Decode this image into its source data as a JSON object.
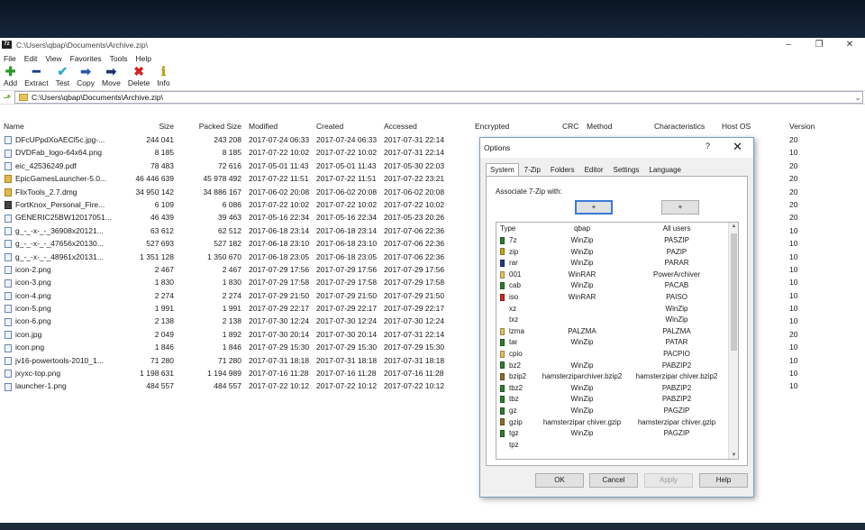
{
  "window": {
    "title": "C:\\Users\\qbap\\Documents\\Archive.zip\\",
    "app_icon_text": "7z"
  },
  "menu": [
    "File",
    "Edit",
    "View",
    "Favorites",
    "Tools",
    "Help"
  ],
  "toolbar": [
    {
      "label": "Add",
      "icon": "plus-icon",
      "glyph": "✚",
      "color": "#2a9a2a"
    },
    {
      "label": "Extract",
      "icon": "minus-icon",
      "glyph": "━",
      "color": "#1e3f8c"
    },
    {
      "label": "Test",
      "icon": "check-icon",
      "glyph": "✔",
      "color": "#2aa9c9"
    },
    {
      "label": "Copy",
      "icon": "copy-arrow-icon",
      "glyph": "➡",
      "color": "#2a5aa9"
    },
    {
      "label": "Move",
      "icon": "move-arrow-icon",
      "glyph": "➡",
      "color": "#1e2f6c"
    },
    {
      "label": "Delete",
      "icon": "delete-x-icon",
      "glyph": "✖",
      "color": "#d42020"
    },
    {
      "label": "Info",
      "icon": "info-icon",
      "glyph": "ℹ",
      "color": "#c29a10"
    }
  ],
  "address": {
    "value": "C:\\Users\\qbap\\Documents\\Archive.zip\\"
  },
  "columns": [
    "Name",
    "Size",
    "Packed Size",
    "Modified",
    "Created",
    "Accessed",
    "Encrypted",
    "CRC",
    "Method",
    "Characteristics",
    "Host OS",
    "Version"
  ],
  "files": [
    {
      "name": "DFcUPpdXoAECl5c.jpg-...",
      "size": "244 041",
      "packed": "243 208",
      "modified": "2017-07-24 06:33",
      "created": "2017-07-24 06:33",
      "accessed": "2017-07-31 22:14",
      "version": "20",
      "kind": "file"
    },
    {
      "name": "DVDFab_logo-64x64.png",
      "size": "8 185",
      "packed": "8 185",
      "modified": "2017-07-22 10:02",
      "created": "2017-07-22 10:02",
      "accessed": "2017-07-31 22:14",
      "version": "10",
      "kind": "file"
    },
    {
      "name": "eic_42536249.pdf",
      "size": "78 483",
      "packed": "72 616",
      "modified": "2017-05-01 11:43",
      "created": "2017-05-01 11:43",
      "accessed": "2017-05-30 22:03",
      "version": "20",
      "kind": "file"
    },
    {
      "name": "EpicGamesLauncher-5.0...",
      "size": "46 446 639",
      "packed": "45 978 492",
      "modified": "2017-07-22 11:51",
      "created": "2017-07-22 11:51",
      "accessed": "2017-07-22 23:21",
      "version": "20",
      "kind": "folder"
    },
    {
      "name": "FlixTools_2.7.dmg",
      "size": "34 950 142",
      "packed": "34 886 167",
      "modified": "2017-06-02 20:08",
      "created": "2017-06-02 20:08",
      "accessed": "2017-06-02 20:08",
      "version": "20",
      "kind": "folder"
    },
    {
      "name": "FortKnox_Personal_Fire...",
      "size": "6 109",
      "packed": "6 086",
      "modified": "2017-07-22 10:02",
      "created": "2017-07-22 10:02",
      "accessed": "2017-07-22 10:02",
      "version": "20",
      "kind": "app"
    },
    {
      "name": "GENERIC25BW12017051...",
      "size": "46 439",
      "packed": "39 463",
      "modified": "2017-05-16 22:34",
      "created": "2017-05-16 22:34",
      "accessed": "2017-05-23 20:26",
      "version": "20",
      "kind": "file"
    },
    {
      "name": "g_-_-x-_-_36908x20121...",
      "size": "63 612",
      "packed": "62 512",
      "modified": "2017-06-18 23:14",
      "created": "2017-06-18 23:14",
      "accessed": "2017-07-06 22:36",
      "version": "10",
      "kind": "file"
    },
    {
      "name": "g_-_-x-_-_47656x20130...",
      "size": "527 693",
      "packed": "527 182",
      "modified": "2017-06-18 23:10",
      "created": "2017-06-18 23:10",
      "accessed": "2017-07-06 22:36",
      "version": "10",
      "kind": "file"
    },
    {
      "name": "g_-_-x-_-_48961x20131...",
      "size": "1 351 128",
      "packed": "1 350 670",
      "modified": "2017-06-18 23:05",
      "created": "2017-06-18 23:05",
      "accessed": "2017-07-06 22:36",
      "version": "10",
      "kind": "file"
    },
    {
      "name": "icon-2.png",
      "size": "2 467",
      "packed": "2 467",
      "modified": "2017-07-29 17:56",
      "created": "2017-07-29 17:56",
      "accessed": "2017-07-29 17:56",
      "version": "10",
      "kind": "file"
    },
    {
      "name": "icon-3.png",
      "size": "1 830",
      "packed": "1 830",
      "modified": "2017-07-29 17:58",
      "created": "2017-07-29 17:58",
      "accessed": "2017-07-29 17:58",
      "version": "10",
      "kind": "file"
    },
    {
      "name": "icon-4.png",
      "size": "2 274",
      "packed": "2 274",
      "modified": "2017-07-29 21:50",
      "created": "2017-07-29 21:50",
      "accessed": "2017-07-29 21:50",
      "version": "10",
      "kind": "file"
    },
    {
      "name": "icon-5.png",
      "size": "1 991",
      "packed": "1 991",
      "modified": "2017-07-29 22:17",
      "created": "2017-07-29 22:17",
      "accessed": "2017-07-29 22:17",
      "version": "10",
      "kind": "file"
    },
    {
      "name": "icon-6.png",
      "size": "2 138",
      "packed": "2 138",
      "modified": "2017-07-30 12:24",
      "created": "2017-07-30 12:24",
      "accessed": "2017-07-30 12:24",
      "version": "10",
      "kind": "file"
    },
    {
      "name": "icon.jpg",
      "size": "2 049",
      "packed": "1 892",
      "modified": "2017-07-30 20:14",
      "created": "2017-07-30 20:14",
      "accessed": "2017-07-31 22:14",
      "version": "20",
      "kind": "file"
    },
    {
      "name": "icon.png",
      "size": "1 846",
      "packed": "1 846",
      "modified": "2017-07-29 15:30",
      "created": "2017-07-29 15:30",
      "accessed": "2017-07-29 15:30",
      "version": "10",
      "kind": "file"
    },
    {
      "name": "jv16-powertools-2010_1...",
      "size": "71 280",
      "packed": "71 280",
      "modified": "2017-07-31 18:18",
      "created": "2017-07-31 18:18",
      "accessed": "2017-07-31 18:18",
      "version": "10",
      "kind": "file"
    },
    {
      "name": "jxyxc-top.png",
      "size": "1 198 631",
      "packed": "1 194 989",
      "modified": "2017-07-16 11:28",
      "created": "2017-07-16 11:28",
      "accessed": "2017-07-16 11:28",
      "version": "10",
      "kind": "file"
    },
    {
      "name": "launcher-1.png",
      "size": "484 557",
      "packed": "484 557",
      "modified": "2017-07-22 10:12",
      "created": "2017-07-22 10:12",
      "accessed": "2017-07-22 10:12",
      "version": "10",
      "kind": "file"
    }
  ],
  "dialog": {
    "title": "Options",
    "help": "?",
    "close": "✕",
    "tabs": [
      "System",
      "7-Zip",
      "Folders",
      "Editor",
      "Settings",
      "Language"
    ],
    "associate_label": "Associate 7-Zip with:",
    "plus_labels": [
      "+",
      "+"
    ],
    "table_headers": [
      "Type",
      "qbap",
      "All users"
    ],
    "associations": [
      {
        "ext": "7z",
        "user": "WinZip",
        "all": "PASZIP",
        "color": "#2e7d32"
      },
      {
        "ext": "zip",
        "user": "WinZip",
        "all": "PAZIP",
        "color": "#c9a227"
      },
      {
        "ext": "rar",
        "user": "WinZip",
        "all": "PARAR",
        "color": "#283593"
      },
      {
        "ext": "001",
        "user": "WinRAR",
        "all": "PowerArchiver",
        "color": "#e0c060"
      },
      {
        "ext": "cab",
        "user": "WinZip",
        "all": "PACAB",
        "color": "#2e7d32"
      },
      {
        "ext": "iso",
        "user": "WinRAR",
        "all": "PAISO",
        "color": "#c62828"
      },
      {
        "ext": "xz",
        "user": "",
        "all": "WinZip",
        "color": ""
      },
      {
        "ext": "txz",
        "user": "",
        "all": "WinZip",
        "color": ""
      },
      {
        "ext": "lzma",
        "user": "PALZMA",
        "all": "PALZMA",
        "color": "#e0c060"
      },
      {
        "ext": "tar",
        "user": "WinZip",
        "all": "PATAR",
        "color": "#2e7d32"
      },
      {
        "ext": "cpio",
        "user": "",
        "all": "PACPIO",
        "color": "#e0c060"
      },
      {
        "ext": "bz2",
        "user": "WinZip",
        "all": "PABZIP2",
        "color": "#2e7d32"
      },
      {
        "ext": "bzip2",
        "user": "hamsterziparchiver.bzip2",
        "all": "hamsterzipar chiver.bzip2",
        "color": "#8d6e2a"
      },
      {
        "ext": "tbz2",
        "user": "WinZip",
        "all": "PABZIP2",
        "color": "#2e7d32"
      },
      {
        "ext": "tbz",
        "user": "WinZip",
        "all": "PABZIP2",
        "color": "#2e7d32"
      },
      {
        "ext": "gz",
        "user": "WinZip",
        "all": "PAGZIP",
        "color": "#2e7d32"
      },
      {
        "ext": "gzip",
        "user": "hamsterzipar chiver.gzip",
        "all": "hamsterzipar chiver.gzip",
        "color": "#8d6e2a"
      },
      {
        "ext": "tgz",
        "user": "WinZip",
        "all": "PAGZIP",
        "color": "#2e7d32"
      },
      {
        "ext": "tpz",
        "user": "",
        "all": "",
        "color": ""
      }
    ],
    "buttons": [
      "OK",
      "Cancel",
      "Apply",
      "Help"
    ]
  }
}
